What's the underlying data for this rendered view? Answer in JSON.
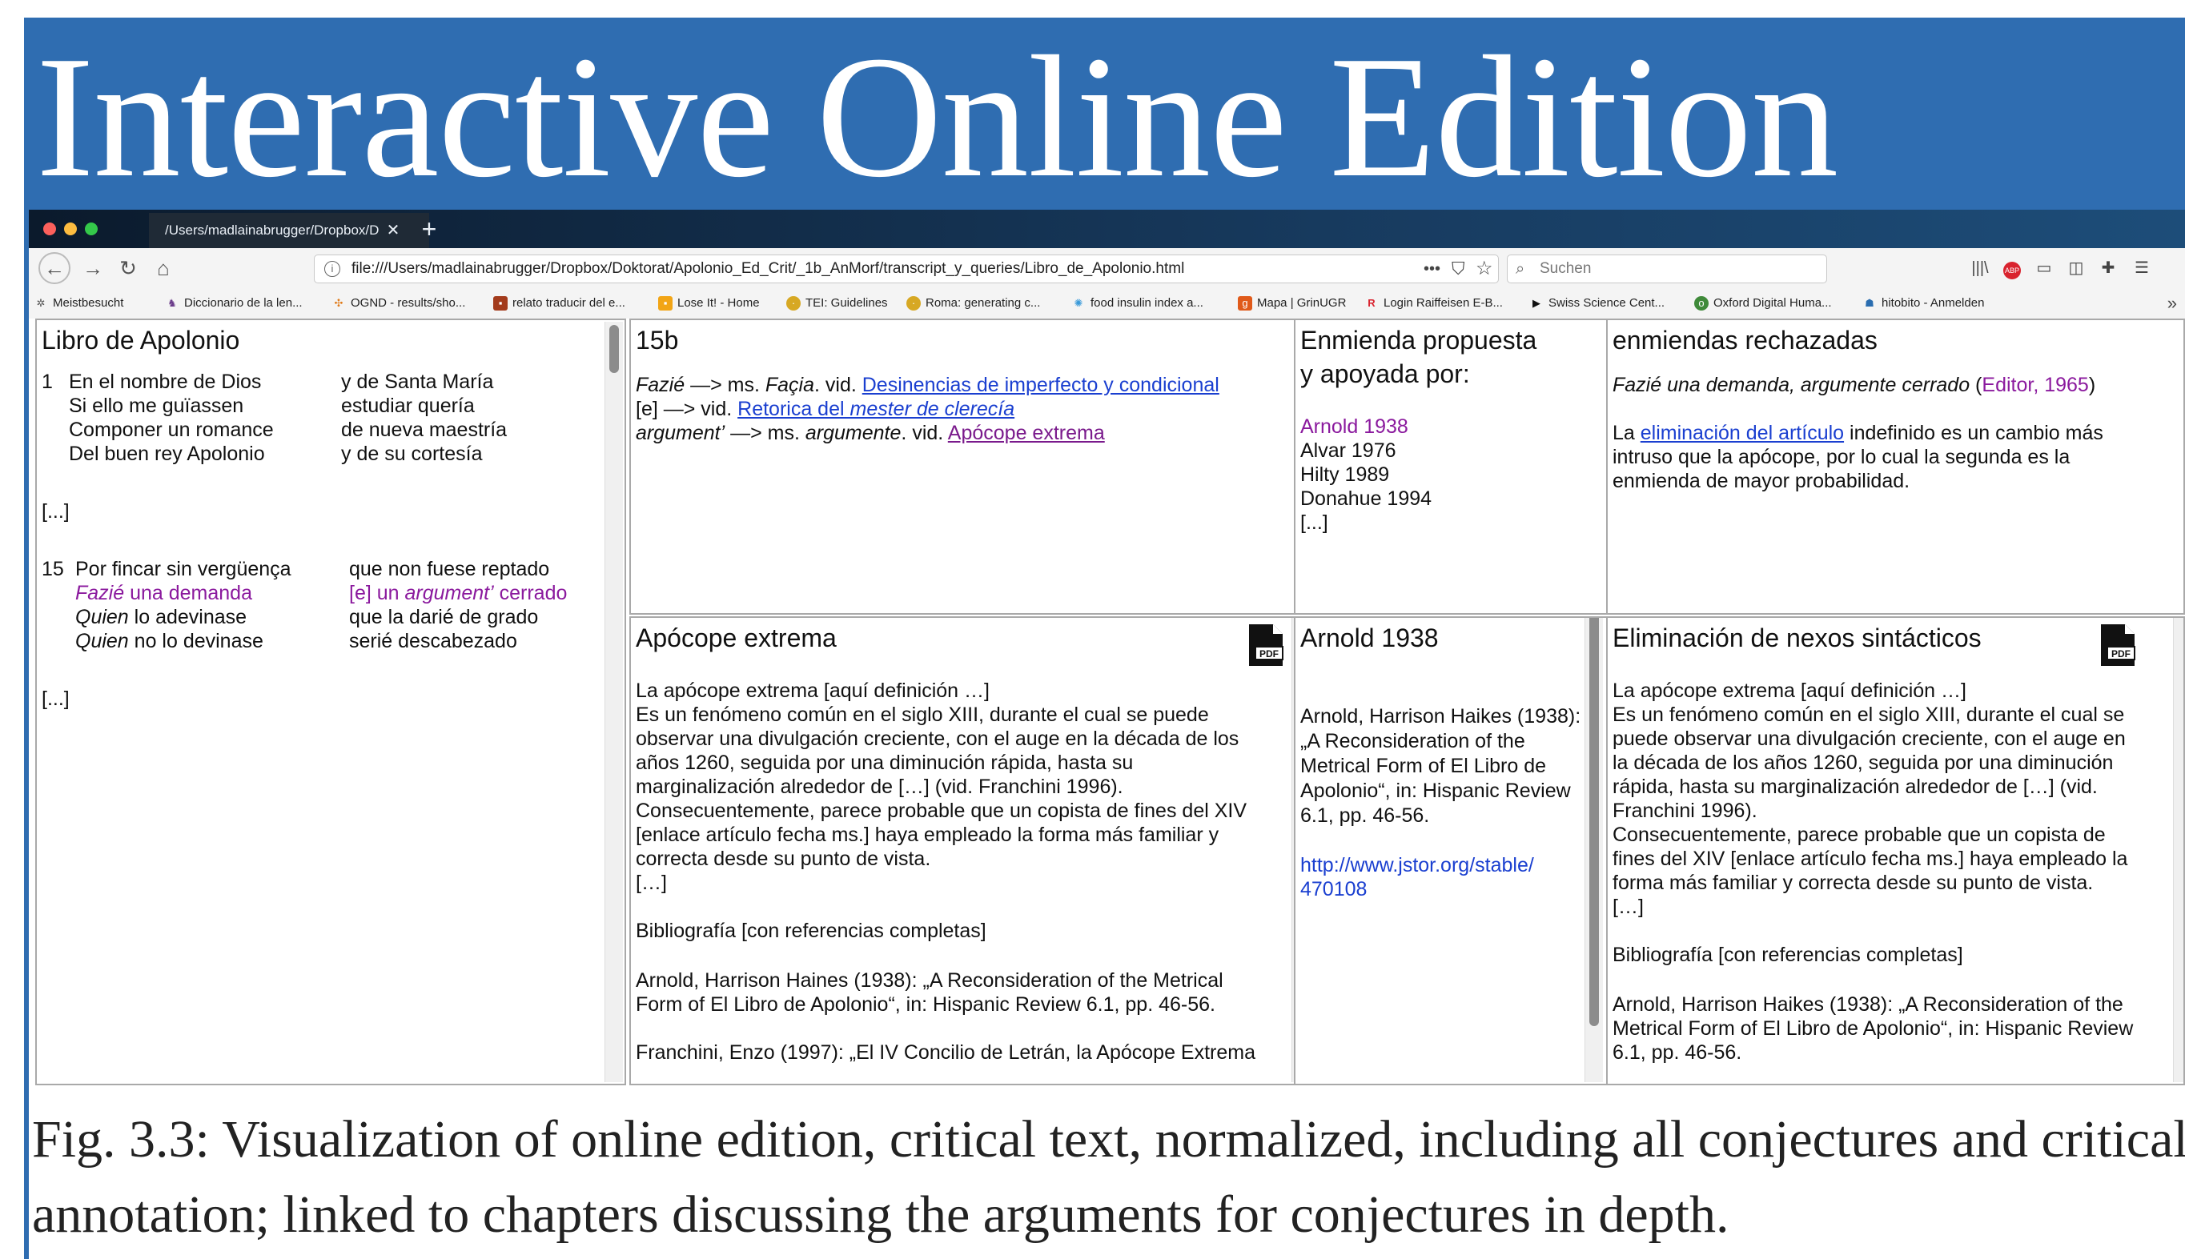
{
  "slide": {
    "title": "Interactive Online Edition",
    "caption_line1": "Fig. 3.3: Visualization of online edition, critical text, normalized, including all conjectures and critical",
    "caption_line2": "annotation; linked to chapters discussing the arguments for conjectures in depth.",
    "accent_color": "#2f6db1"
  },
  "browser": {
    "tab_title": "/Users/madlainabrugger/Dropbox/D",
    "tab_close": "✕",
    "new_tab": "+",
    "url": "file:///Users/madlainabrugger/Dropbox/Doktorat/Apolonio_Ed_Crit/_1b_AnMorf/transcript_y_queries/Libro_de_Apolonio.html",
    "url_menu": "•••",
    "search_placeholder": "Suchen",
    "bookmarks": [
      {
        "label": "Meistbesucht",
        "icon": "gear-icon"
      },
      {
        "label": "Diccionario de la len...",
        "icon": "rae-icon"
      },
      {
        "label": "OGND - results/sho...",
        "icon": "ognd-icon"
      },
      {
        "label": "relato traducir del e...",
        "icon": "book-icon"
      },
      {
        "label": "Lose It! - Home",
        "icon": "loseit-icon"
      },
      {
        "label": "TEI: Guidelines",
        "icon": "tei-icon"
      },
      {
        "label": "Roma: generating c...",
        "icon": "tei-icon"
      },
      {
        "label": "food insulin index a...",
        "icon": "flower-icon"
      },
      {
        "label": "Mapa | GrinUGR",
        "icon": "grin-icon"
      },
      {
        "label": "Login Raiffeisen E-B...",
        "icon": "raiffeisen-icon"
      },
      {
        "label": "Swiss Science Cent...",
        "icon": "play-icon"
      },
      {
        "label": "Oxford Digital Huma...",
        "icon": "oxford-icon"
      },
      {
        "label": "hitobito - Anmelden",
        "icon": "hitobito-icon"
      }
    ]
  },
  "panes": {
    "text": {
      "title": "Libro de Apolonio",
      "stanza1": {
        "number": "1",
        "left": [
          "En el nombre de Dios",
          "Si ello me guïassen",
          "Componer un romance",
          "Del buen rey Apolonio"
        ],
        "right": [
          "y de Santa María",
          "estudiar quería",
          "de nueva maestría",
          "y de su cortesía"
        ]
      },
      "ellipsis": "[...]",
      "stanza15": {
        "number": "15",
        "l1": "Por fincar sin vergüença",
        "l2_em": "Fazié",
        "l2_rest": " una demanda",
        "l3_em": "Quien",
        "l3_rest": " lo adevinase",
        "l4_em": "Quien",
        "l4_rest": " no lo devinase",
        "r1": "que non fuese reptado",
        "r2_pre": "[e] un ",
        "r2_em": "argument’",
        "r2_post": " cerrado",
        "r3": "que la darié  de grado",
        "r4": "serié descabezado"
      }
    },
    "notes": {
      "title": "15b",
      "n1_em": "Fazié",
      "n1_mid": " —> ms. ",
      "n1_ms": "Façia",
      "n1_vid": ". vid. ",
      "n1_link": "Desinencias de imperfecto y condicional",
      "n2_pre": "[e] —> vid. ",
      "n2_link_a": "Retorica del ",
      "n2_link_em": "mester de clerecía",
      "n3_em": "argument’",
      "n3_mid": " —> ms. ",
      "n3_ms": "argumente",
      "n3_vid": ". vid. ",
      "n3_link": "Apócope extrema"
    },
    "support": {
      "title_line1": "Enmienda propuesta",
      "title_line2": "y apoyada por:",
      "items": [
        "Arnold 1938",
        "Alvar 1976",
        "Hilty 1989",
        "Donahue 1994",
        "[...]"
      ],
      "highlight_color": "#8b1a9e"
    },
    "rejected": {
      "title": "enmiendas rechazadas",
      "line1_em": "Fazié una demanda, argumente cerrado",
      "line1_paren_open": " (",
      "line1_ref": "Editor, 1965",
      "line1_paren_close": ")",
      "p_pre": "La ",
      "p_link": "eliminación del artículo",
      "p_rest1": " indefinido es un cambio más",
      "p_rest2": "intruso que la apócope, por lo cual la segunda es la",
      "p_rest3": "enmienda de mayor probabilidad."
    },
    "apocope": {
      "title": "Apócope extrema",
      "lines": [
        "La apócope extrema [aquí definición …]",
        "Es un fenómeno común en el siglo XIII, durante el cual se puede",
        "observar una divulgación creciente, con el auge en la década de los",
        "años 1260, seguida por una diminución rápida, hasta su",
        "marginalización alrededor de […] (vid. Franchini 1996).",
        "Consecuentemente, parece probable que un copista de fines del XIV",
        "[enlace artículo fecha ms.] haya empleado la forma más familiar y",
        "correcta desde su punto de vista.",
        "[…]"
      ],
      "biblio_heading": "Bibliografía [con referencias completas]",
      "ref1_a": "Arnold, Harrison Haines (1938): „A Reconsideration of the Metrical",
      "ref1_b": "Form of El Libro de Apolonio“, in: Hispanic Review 6.1, pp. 46-56.",
      "ref2": "Franchini, Enzo (1997): „El IV Concilio de Letrán, la Apócope Extrema"
    },
    "arnold": {
      "title": "Arnold 1938",
      "lines": [
        "Arnold, Harrison Haikes (1938):",
        "„A Reconsideration of the",
        "Metrical Form of El Libro de",
        "Apolonio“, in: Hispanic Review",
        "6.1, pp. 46-56."
      ],
      "url_line1": "http://www.jstor.org/stable/",
      "url_line2": "470108"
    },
    "nexos": {
      "title": "Eliminación de nexos sintácticos",
      "lines": [
        "La apócope extrema [aquí definición …]",
        "Es un fenómeno común en el siglo XIII, durante el cual se",
        "puede observar una divulgación creciente, con el auge en",
        "la década de los años 1260, seguida por una diminución",
        "rápida, hasta su marginalización alrededor de […] (vid.",
        "Franchini 1996).",
        "Consecuentemente, parece probable que un copista de",
        "fines del XIV [enlace artículo fecha ms.] haya empleado la",
        "forma más familiar y correcta desde su punto de vista.",
        "[…]"
      ],
      "biblio_heading": "Bibliografía [con referencias completas]",
      "ref1_a": "Arnold, Harrison Haikes (1938): „A Reconsideration of the",
      "ref1_b": "Metrical Form of El Libro de Apolonio“, in: Hispanic Review",
      "ref1_c": "6.1, pp. 46-56."
    }
  }
}
